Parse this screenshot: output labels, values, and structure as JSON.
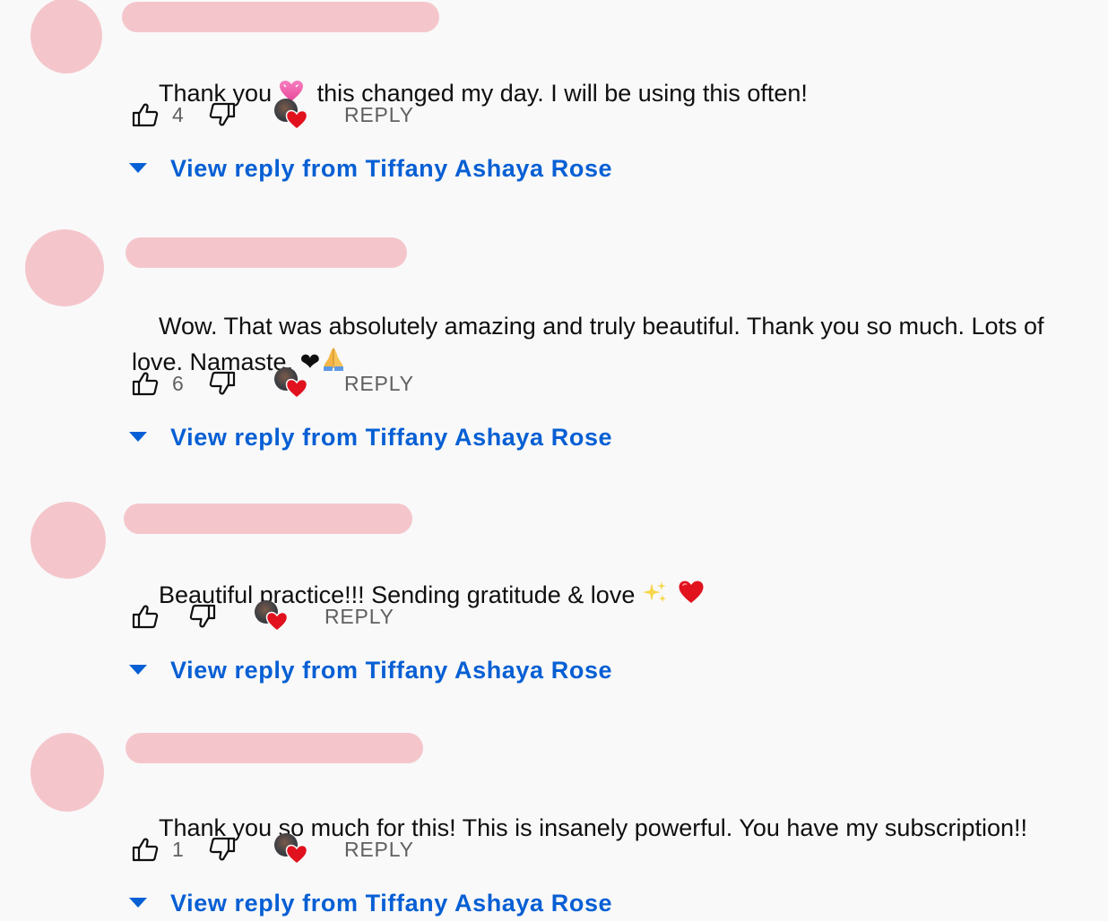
{
  "comments": [
    {
      "text_before": "Thank you ",
      "emoji_mid": "pink-heart",
      "text_after": "  this changed my day. I will be using this often!",
      "likes": "4",
      "reply_label": "REPLY",
      "view_replies_label": "View reply from Tiffany Ashaya Rose"
    },
    {
      "text": "Wow. That was absolutely amazing and truly beautiful. Thank you so much. Lots of love. Namaste. ❤",
      "emoji_end": "folded-hands",
      "likes": "6",
      "reply_label": "REPLY",
      "view_replies_label": "View reply from Tiffany Ashaya Rose"
    },
    {
      "text": "Beautiful practice!!! Sending gratitude & love ",
      "emoji_end": "sparkles red-heart",
      "likes": "",
      "reply_label": "REPLY",
      "view_replies_label": "View reply from Tiffany Ashaya Rose"
    },
    {
      "text": "Thank you so much for this! This is insanely powerful. You have my subscription!!",
      "likes": "1",
      "reply_label": "REPLY",
      "view_replies_label": "View reply from Tiffany Ashaya Rose"
    }
  ],
  "icons": {
    "like": "thumbs-up-icon",
    "dislike": "thumbs-down-icon",
    "creator_heart": "creator-heart-icon",
    "expand": "caret-down-icon"
  },
  "colors": {
    "background": "#f9f9f9",
    "link_blue": "#065fd4",
    "secondary_text": "#606060",
    "redaction_pink": "#f4c6cc",
    "heart_red": "#e1111e"
  }
}
